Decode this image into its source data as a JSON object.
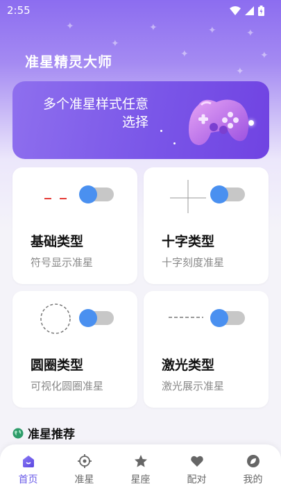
{
  "status_bar": {
    "time": "2:55"
  },
  "app": {
    "title": "准星精灵大师"
  },
  "banner": {
    "text": "多个准星样式任意选择"
  },
  "cards": [
    {
      "title": "基础类型",
      "subtitle": "符号显示准星"
    },
    {
      "title": "十字类型",
      "subtitle": "十字刻度准星"
    },
    {
      "title": "圆圈类型",
      "subtitle": "可视化圆圈准星"
    },
    {
      "title": "激光类型",
      "subtitle": "激光展示准星"
    }
  ],
  "section": {
    "title": "准星推荐"
  },
  "tabs": [
    {
      "label": "首页",
      "icon": "home-icon",
      "active": true
    },
    {
      "label": "准星",
      "icon": "crosshair-icon"
    },
    {
      "label": "星座",
      "icon": "star-icon"
    },
    {
      "label": "配对",
      "icon": "heart-icon"
    },
    {
      "label": "我的",
      "icon": "profile-icon"
    }
  ],
  "colors": {
    "accent": "#6a5be8",
    "toggle_knob": "#4a90f0",
    "primary_purple": "#7a56e8"
  }
}
